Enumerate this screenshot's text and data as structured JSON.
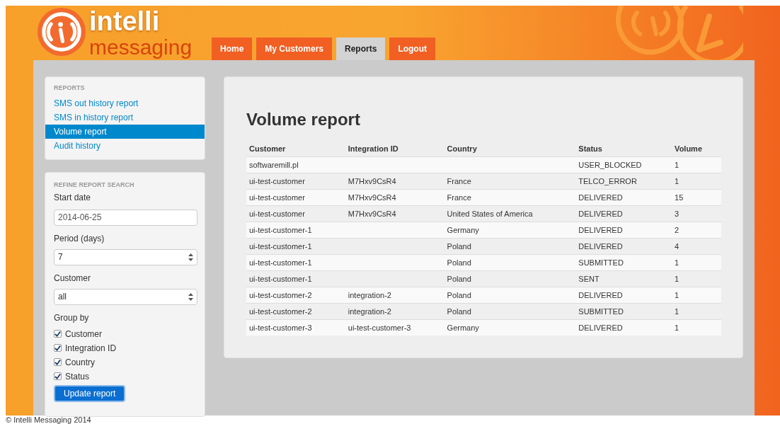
{
  "logo": {
    "line_1": "intelli",
    "line_2": "messaging"
  },
  "nav": [
    {
      "label": "Home",
      "selected": false
    },
    {
      "label": "My Customers",
      "selected": false
    },
    {
      "label": "Reports",
      "selected": true
    },
    {
      "label": "Logout",
      "selected": false
    }
  ],
  "reports_menu": {
    "heading": "REPORTS",
    "items": [
      {
        "label": "SMS out history report",
        "selected": false
      },
      {
        "label": "SMS in history report",
        "selected": false
      },
      {
        "label": "Volume report",
        "selected": true
      },
      {
        "label": "Audit history",
        "selected": false
      }
    ]
  },
  "refine": {
    "heading": "REFINE REPORT SEARCH",
    "fields": [
      {
        "kind": "text",
        "label": "Start date",
        "value": "2014-06-25"
      },
      {
        "kind": "select",
        "label": "Period (days)",
        "value": "7"
      },
      {
        "kind": "select",
        "label": "Customer",
        "value": "all"
      }
    ],
    "group_by_label": "Group by",
    "group_by": [
      {
        "label": "Customer",
        "checked": true
      },
      {
        "label": "Integration ID",
        "checked": true
      },
      {
        "label": "Country",
        "checked": true
      },
      {
        "label": "Status",
        "checked": true
      }
    ],
    "button": "Update report"
  },
  "report": {
    "title": "Volume report",
    "columns": [
      "Customer",
      "Integration ID",
      "Country",
      "Status",
      "Volume"
    ],
    "rows": [
      [
        "softwaremill.pl",
        null,
        null,
        "USER_BLOCKED",
        "1"
      ],
      [
        "ui-test-customer",
        "M7Hxv9CsR4",
        "France",
        "TELCO_ERROR",
        "1"
      ],
      [
        "ui-test-customer",
        "M7Hxv9CsR4",
        "France",
        "DELIVERED",
        "15"
      ],
      [
        "ui-test-customer",
        "M7Hxv9CsR4",
        "United States of America",
        "DELIVERED",
        "3"
      ],
      [
        "ui-test-customer-1",
        null,
        "Germany",
        "DELIVERED",
        "2"
      ],
      [
        "ui-test-customer-1",
        null,
        "Poland",
        "DELIVERED",
        "4"
      ],
      [
        "ui-test-customer-1",
        null,
        "Poland",
        "SUBMITTED",
        "1"
      ],
      [
        "ui-test-customer-1",
        null,
        "Poland",
        "SENT",
        "1"
      ],
      [
        "ui-test-customer-2",
        "integration-2",
        "Poland",
        "DELIVERED",
        "1"
      ],
      [
        "ui-test-customer-2",
        "integration-2",
        "Poland",
        "SUBMITTED",
        "1"
      ],
      [
        "ui-test-customer-3",
        "ui-test-customer-3",
        "Germany",
        "DELIVERED",
        "1"
      ]
    ]
  },
  "footer": "© Intelli Messaging 2014"
}
